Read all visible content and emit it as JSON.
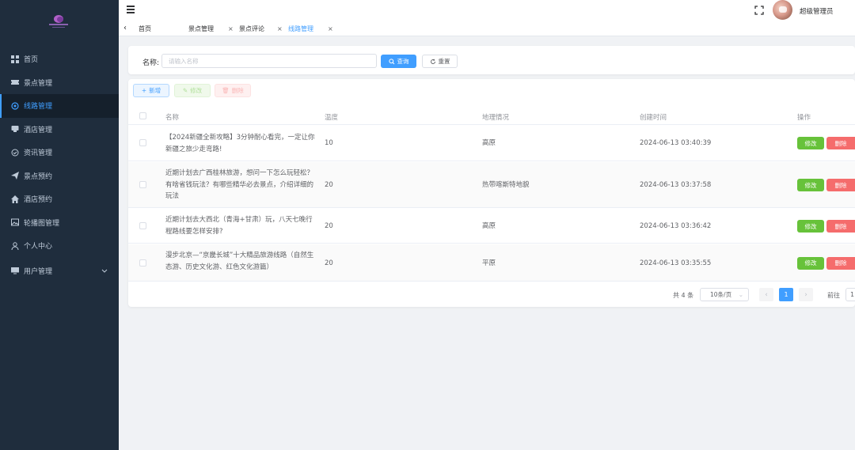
{
  "sidebar": {
    "items": [
      {
        "label": "首页",
        "icon": "dashboard-icon"
      },
      {
        "label": "景点管理",
        "icon": "ticket-icon"
      },
      {
        "label": "线路管理",
        "icon": "route-icon",
        "active": true
      },
      {
        "label": "酒店管理",
        "icon": "hotel-icon"
      },
      {
        "label": "资讯管理",
        "icon": "news-icon"
      },
      {
        "label": "景点预约",
        "icon": "send-icon"
      },
      {
        "label": "酒店预约",
        "icon": "home-icon"
      },
      {
        "label": "轮播图管理",
        "icon": "image-icon"
      },
      {
        "label": "个人中心",
        "icon": "user-icon"
      },
      {
        "label": "用户管理",
        "icon": "monitor-icon",
        "has_children": true
      }
    ]
  },
  "header": {
    "username": "超级管理员"
  },
  "tags": [
    {
      "label": "首页",
      "closable": false
    },
    {
      "label": "景点管理",
      "closable": true
    },
    {
      "label": "景点评论",
      "closable": true
    },
    {
      "label": "线路管理",
      "closable": true,
      "active": true
    }
  ],
  "search": {
    "label": "名称:",
    "placeholder": "请输入名称",
    "value": "",
    "query_label": "查询",
    "reset_label": "重置"
  },
  "toolbar": {
    "add_label": "新增",
    "edit_label": "修改",
    "delete_label": "删除"
  },
  "table": {
    "columns": [
      "名称",
      "温度",
      "地理情况",
      "创建时间",
      "操作"
    ],
    "rows": [
      {
        "name": "【2024新疆全新攻略】3分钟耐心看完，一定让你新疆之旅少走弯路!",
        "temp": "10",
        "geo": "高原",
        "created": "2024-06-13 03:40:39"
      },
      {
        "name": "近期计划去广西桂林旅游，想问一下怎么玩轻松？有啥省钱玩法？有哪些精华必去景点，介绍详细的玩法",
        "temp": "20",
        "geo": "热带喀斯特地貌",
        "created": "2024-06-13 03:37:58"
      },
      {
        "name": "近期计划去大西北（青海+甘肃）玩，八天七晚行程路线要怎样安排?",
        "temp": "20",
        "geo": "高原",
        "created": "2024-06-13 03:36:42"
      },
      {
        "name": "漫步北京—“京畿长城”十大精品旅游线路（自然生态游、历史文化游、红色文化游篇）",
        "temp": "20",
        "geo": "平原",
        "created": "2024-06-13 03:35:55"
      }
    ],
    "row_edit_label": "修改",
    "row_delete_label": "删除"
  },
  "pagination": {
    "total_text": "共 4 条",
    "page_size": "10条/页",
    "current_page": "1",
    "goto_label": "前往",
    "goto_value": "1"
  },
  "colors": {
    "sidebar_bg": "#1f2d3d",
    "primary": "#409eff",
    "success": "#67c23a",
    "danger": "#f56c6c"
  }
}
